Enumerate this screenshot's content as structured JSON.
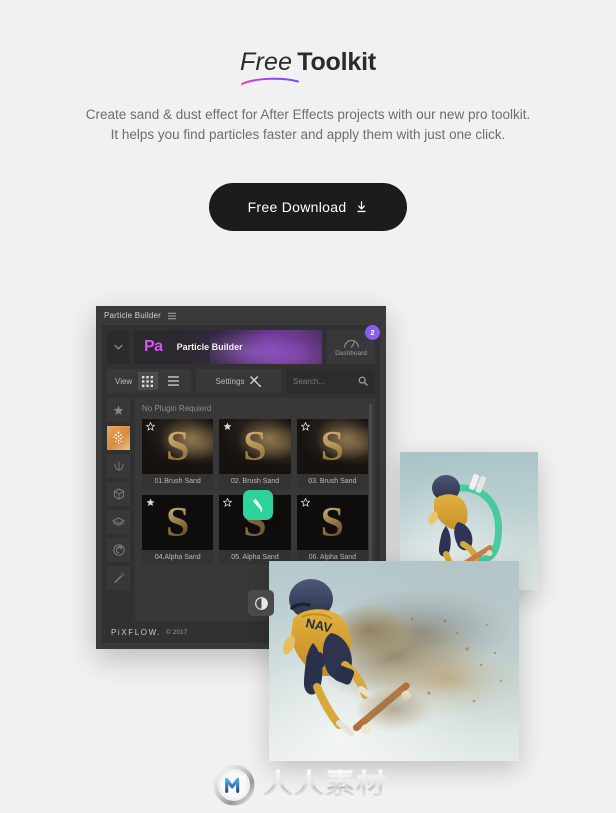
{
  "page": {
    "background_color": "#f1f1f1"
  },
  "hero": {
    "title_light": "Free",
    "title_bold": "Toolkit",
    "underline_color": "#a43bf0",
    "subtitle_line1": "Create sand & dust effect for After Effects projects with our new pro toolkit.",
    "subtitle_line2": "It helps you find particles faster and apply them with just one click.",
    "cta_label": "Free Download",
    "cta_icon": "download-icon",
    "cta_bg_color": "#1c1c1c"
  },
  "app": {
    "titlebar": {
      "title": "Particle Builder",
      "menu_icon": "hamburger-icon"
    },
    "brand": {
      "caret_icon": "chevron-down-icon",
      "logo_text": "Pa",
      "logo_color": "#d654ef",
      "product_name": "Particle Builder",
      "dashboard_label": "Dashboard",
      "dashboard_icon": "gauge-icon",
      "dashboard_badge": "2",
      "badge_color": "#8a5cf0"
    },
    "toolbar": {
      "view_label": "View",
      "view_grid_icon": "grid-view-icon",
      "view_list_icon": "list-view-icon",
      "view_active": "grid",
      "settings_label": "Settings",
      "settings_icon": "tools-icon",
      "search_placeholder": "Search...",
      "search_value": "",
      "search_icon": "search-icon"
    },
    "sidebar": {
      "items": [
        {
          "icon": "star-icon",
          "active": false
        },
        {
          "icon": "particles-icon",
          "active": true
        },
        {
          "icon": "laurel-wreath-icon",
          "active": false
        },
        {
          "icon": "cube-icon",
          "active": false
        },
        {
          "icon": "layers-icon",
          "active": false
        },
        {
          "icon": "spiral-icon",
          "active": false
        },
        {
          "icon": "magic-wand-icon",
          "active": false
        }
      ],
      "active_color": "#d98a3e"
    },
    "content": {
      "section_heading": "No Plugin Requierd",
      "items": [
        {
          "label": "01.Brush Sand",
          "starred": false,
          "kind": "brush"
        },
        {
          "label": "02. Brush Sand",
          "starred": true,
          "kind": "brush"
        },
        {
          "label": "03. Brush Sand",
          "starred": false,
          "kind": "brush"
        },
        {
          "label": "04.Alpha Sand",
          "starred": true,
          "kind": "alpha"
        },
        {
          "label": "05. Alpha Sand",
          "starred": false,
          "kind": "alpha"
        },
        {
          "label": "06. Alpha Sand",
          "starred": false,
          "kind": "alpha"
        }
      ],
      "thumb_letter": "S",
      "badges": [
        {
          "name": "brush-badge",
          "icon": "brush-icon",
          "color": "#2fd39a"
        },
        {
          "name": "alpha-badge",
          "icon": "contrast-icon",
          "color": "#4a4a4a"
        }
      ]
    },
    "footer": {
      "brand": "PiXFLOW.",
      "copyright": "© 2017"
    }
  },
  "photos": [
    {
      "name": "photo-skater-green-arc",
      "subject": "skateboarder mid-air with green arc trail",
      "sky_color": "#b9cfd0"
    },
    {
      "name": "photo-skater-dust-effect",
      "subject": "skateboarder mid-air dispersing into sand and dust",
      "sky_color": "#c3d4d4"
    }
  ],
  "watermark": {
    "logo_icon": "rrsc-circle-logo-icon",
    "text": "人人素材"
  }
}
